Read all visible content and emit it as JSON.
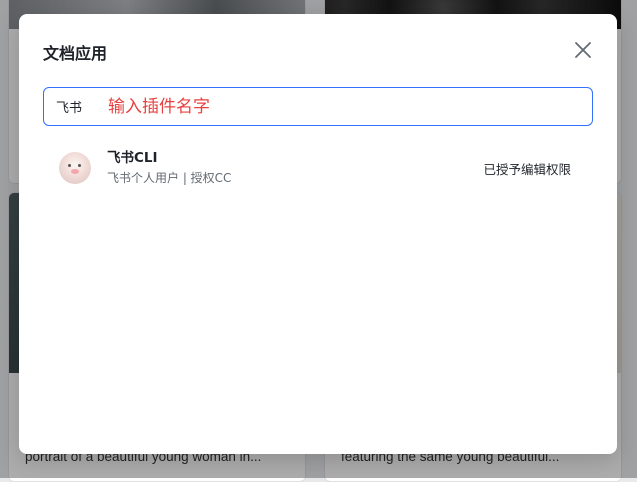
{
  "background": {
    "caption_left": "portrait of a beautiful young woman in...",
    "caption_right": "featuring the same young beautiful..."
  },
  "modal": {
    "title": "文档应用",
    "close_icon": "close-icon",
    "search": {
      "scope_label": "飞书",
      "placeholder": "输入插件名字",
      "value": ""
    },
    "items": [
      {
        "name": "飞书CLI",
        "subtitle": "飞书个人用户 | 授权CC",
        "status": "已授予编辑权限",
        "avatar_icon": "app-avatar-icon"
      }
    ]
  },
  "colors": {
    "accent": "#3370ff",
    "placeholder": "#e8413f",
    "text_primary": "#1f2329",
    "text_secondary": "#646a73"
  }
}
